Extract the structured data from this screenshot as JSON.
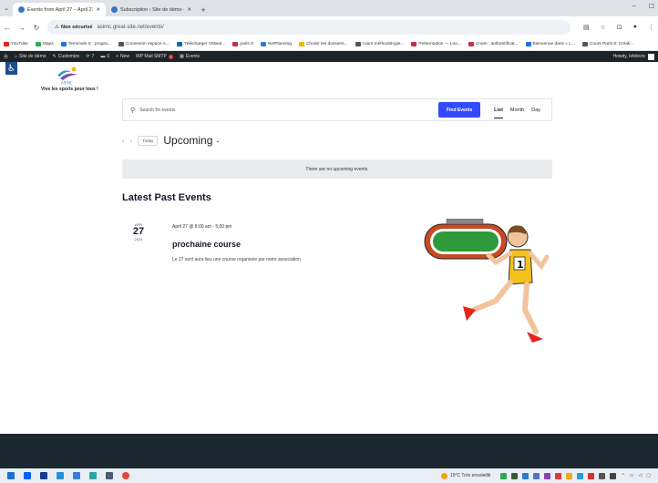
{
  "browser": {
    "tabs": [
      {
        "title": "Events from April 27 – April 27",
        "active": true
      },
      {
        "title": "Subscription ‹ Site de démo —",
        "active": false
      }
    ],
    "security_label": "Non sécurisé",
    "url": "asimc.great-site.net/events/",
    "bookmarks": [
      {
        "label": "YouTube",
        "color": "#e62117"
      },
      {
        "label": "Maps",
        "color": "#34a853"
      },
      {
        "label": "Terminale S : progra...",
        "color": "#1a73e8"
      },
      {
        "label": "Connexion espace A...",
        "color": "#555555"
      },
      {
        "label": "Télécharger VMwar...",
        "color": "#0b6ab5"
      },
      {
        "label": "paris 8",
        "color": "#c4314b"
      },
      {
        "label": "NetPlanning",
        "color": "#2f7fd3"
      },
      {
        "label": "Choisir les dossiers...",
        "color": "#f2b705"
      },
      {
        "label": "cours méthodologie...",
        "color": "#555555"
      },
      {
        "label": "Présentation — Loo...",
        "color": "#c4314b"
      },
      {
        "label": "Cnam : authentificat...",
        "color": "#c4314b"
      },
      {
        "label": "Bienvenue dans « L...",
        "color": "#1a73e8"
      },
      {
        "label": "Cours Paris 8: Créati...",
        "color": "#555555"
      }
    ]
  },
  "wpbar": {
    "site": "Site de démo",
    "customize": "Customize",
    "updates": "7",
    "comments": "0",
    "new": "New",
    "smtp": "WP Mail SMTP",
    "smtp_badge": "!",
    "events": "Events",
    "howdy": "Howdy, lefebvre"
  },
  "site": {
    "logo_text": "ASIMC",
    "tagline": "Vive les sports pour tous !"
  },
  "events_bar": {
    "search_placeholder": "Search for events",
    "find_button": "Find Events",
    "views": [
      "List",
      "Month",
      "Day"
    ],
    "active_view": "List"
  },
  "nav": {
    "today": "Today",
    "upcoming": "Upcoming"
  },
  "notice": "There are no upcoming events.",
  "past": {
    "heading": "Latest Past Events",
    "event": {
      "month": "APR",
      "day": "27",
      "year": "2024",
      "time": "April 27 @ 8:00 am - 5:00 pm",
      "title": "prochaine course",
      "description": "Le 27 avril aura lieu une course organisée par notre association."
    }
  },
  "taskbar": {
    "weather": "19°C  Très ensoleillé"
  }
}
